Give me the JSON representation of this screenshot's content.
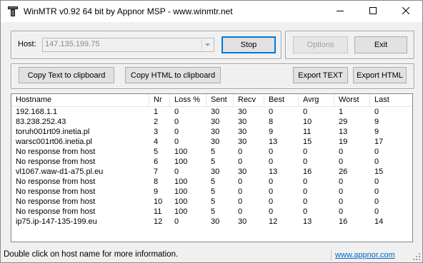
{
  "window": {
    "title": "WinMTR v0.92 64 bit by Appnor MSP - www.winmtr.net"
  },
  "host": {
    "label": "Host:",
    "value": "147.135.199.75"
  },
  "buttons": {
    "stop": "Stop",
    "options": "Options",
    "exit": "Exit",
    "copy_text": "Copy Text to clipboard",
    "copy_html": "Copy HTML to clipboard",
    "export_text": "Export TEXT",
    "export_html": "Export HTML"
  },
  "table": {
    "columns": [
      "Hostname",
      "Nr",
      "Loss %",
      "Sent",
      "Recv",
      "Best",
      "Avrg",
      "Worst",
      "Last"
    ],
    "rows": [
      [
        "192.168.1.1",
        "1",
        "0",
        "30",
        "30",
        "0",
        "0",
        "1",
        "0"
      ],
      [
        "83.238.252.43",
        "2",
        "0",
        "30",
        "30",
        "8",
        "10",
        "29",
        "9"
      ],
      [
        "toruh001rt09.inetia.pl",
        "3",
        "0",
        "30",
        "30",
        "9",
        "11",
        "13",
        "9"
      ],
      [
        "warsc001rt06.inetia.pl",
        "4",
        "0",
        "30",
        "30",
        "13",
        "15",
        "19",
        "17"
      ],
      [
        "No response from host",
        "5",
        "100",
        "5",
        "0",
        "0",
        "0",
        "0",
        "0"
      ],
      [
        "No response from host",
        "6",
        "100",
        "5",
        "0",
        "0",
        "0",
        "0",
        "0"
      ],
      [
        "vl1067.waw-d1-a75.pl.eu",
        "7",
        "0",
        "30",
        "30",
        "13",
        "16",
        "26",
        "15"
      ],
      [
        "No response from host",
        "8",
        "100",
        "5",
        "0",
        "0",
        "0",
        "0",
        "0"
      ],
      [
        "No response from host",
        "9",
        "100",
        "5",
        "0",
        "0",
        "0",
        "0",
        "0"
      ],
      [
        "No response from host",
        "10",
        "100",
        "5",
        "0",
        "0",
        "0",
        "0",
        "0"
      ],
      [
        "No response from host",
        "11",
        "100",
        "5",
        "0",
        "0",
        "0",
        "0",
        "0"
      ],
      [
        "ip75.ip-147-135-199.eu",
        "12",
        "0",
        "30",
        "30",
        "12",
        "13",
        "16",
        "14"
      ]
    ]
  },
  "statusbar": {
    "text": "Double click on host name for more information.",
    "link": "www.appnor.com"
  },
  "icons": {
    "app": "winmtr-app-icon",
    "minimize": "minimize-icon",
    "maximize": "maximize-icon",
    "close": "close-icon",
    "dropdown": "chevron-down-icon",
    "grip": "resize-grip-icon"
  }
}
